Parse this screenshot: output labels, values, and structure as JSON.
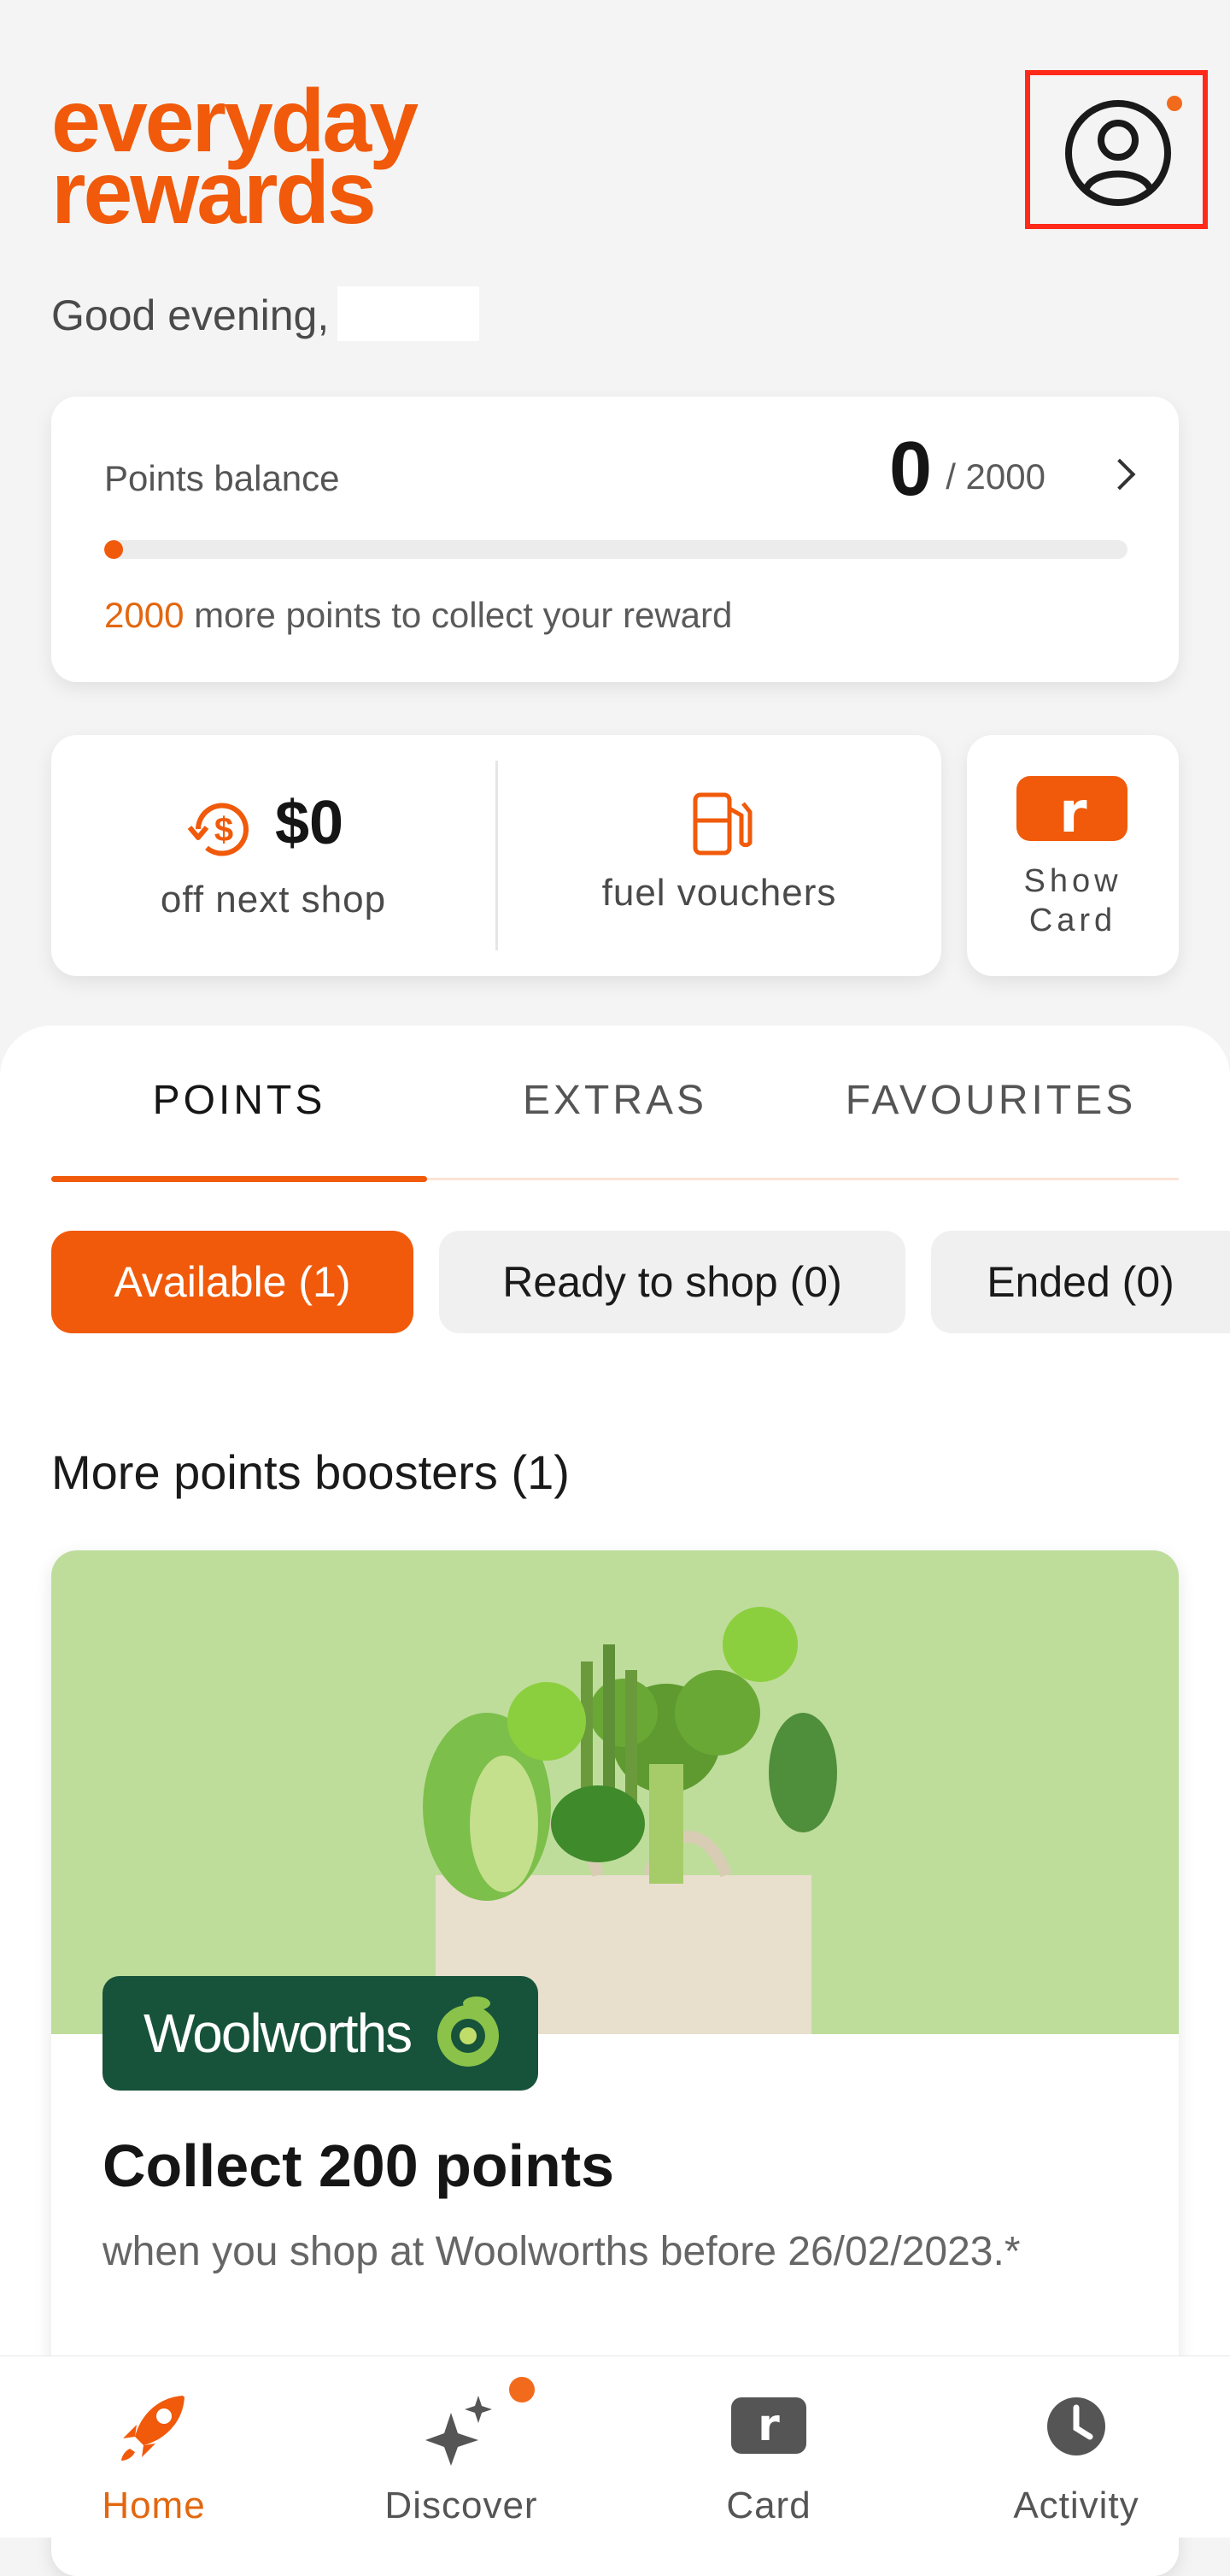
{
  "colors": {
    "brand": "#f05a0a",
    "highlight": "#ff2a1a",
    "woolworths": "#17533a",
    "promo_bg": "#bedd9b"
  },
  "header": {
    "logo_line1": "everyday",
    "logo_line2": "rewards",
    "greeting": "Good evening,",
    "profile_icon": "user-circle-icon"
  },
  "points": {
    "label": "Points balance",
    "value": "0",
    "target": "/ 2000",
    "progress_fraction": 0,
    "remaining": "2000",
    "note": "more points to collect your reward"
  },
  "offers": {
    "amount": "$0",
    "amount_label": "off next shop",
    "fuel_label": "fuel vouchers",
    "show_card_line1": "Show",
    "show_card_line2": "Card",
    "card_glyph": "r"
  },
  "tabs": [
    "POINTS",
    "EXTRAS",
    "FAVOURITES"
  ],
  "filters": [
    "Available (1)",
    "Ready to shop (0)",
    "Ended (0)"
  ],
  "section_title": "More points boosters (1)",
  "booster": {
    "brand": "Woolworths",
    "title": "Collect 200 points",
    "description": "when you shop at Woolworths before 26/02/2023.*"
  },
  "nav": {
    "home": "Home",
    "discover": "Discover",
    "card": "Card",
    "activity": "Activity"
  }
}
